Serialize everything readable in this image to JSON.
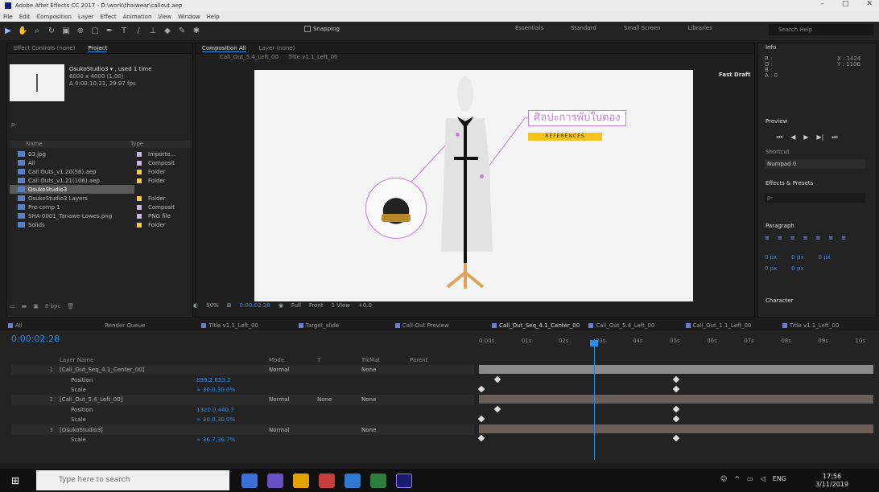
{
  "window": {
    "title": "Adobe After Effects CC 2017 - D:\\work\\thaiwear\\callout.aep"
  },
  "menu": [
    "File",
    "Edit",
    "Composition",
    "Layer",
    "Effect",
    "Animation",
    "View",
    "Window",
    "Help"
  ],
  "toolbar": {
    "snapping_label": "Snapping"
  },
  "workspaces": [
    "Essentials",
    "Standard",
    "Small Screen",
    "Libraries"
  ],
  "search_help": {
    "placeholder": "Search Help"
  },
  "project_panel": {
    "tabs": [
      "Effect Controls (none)",
      "Project"
    ],
    "comp_name": "OsukoStudio3 ▾ , used 1 time",
    "comp_size": "6000 x 4000 (1.00)",
    "comp_duration": "Δ 0:00:10:21, 29.97 fps",
    "headers": [
      "Name",
      "Type"
    ],
    "items": [
      {
        "name": "03.jpg",
        "type": "Importe...",
        "color": "#c7b7e6"
      },
      {
        "name": "All",
        "type": "Composit",
        "color": "#c7b7e6"
      },
      {
        "name": "Call Outs_v1.20(56).aep",
        "type": "Folder",
        "color": "#f2c94c"
      },
      {
        "name": "Call Outs_v1.21(106).aep",
        "type": "Folder",
        "color": "#f2c94c"
      },
      {
        "name": "OsukoStudio3",
        "type": "Composit",
        "color": "#c7b7e6"
      },
      {
        "name": "OsukoStudio3 Layers",
        "type": "Folder",
        "color": "#f2c94c"
      },
      {
        "name": "Pre-comp 1",
        "type": "Composit",
        "color": "#c7b7e6"
      },
      {
        "name": "SHA-0001_Tanawe-Lowes.png",
        "type": "PNG file",
        "color": "#c7b7e6"
      },
      {
        "name": "Solids",
        "type": "Folder",
        "color": "#f2c94c"
      }
    ],
    "footer_bpc": "8 bpc"
  },
  "composition_panel": {
    "tabs": [
      "Composition All",
      "Layer (none)"
    ],
    "breadcrumb": [
      "Call_Out_5.4_Left_00",
      "Title v1.1_Left_00"
    ],
    "frame_label": "Fast Draft",
    "thai_title": "ศิลปะการพับใบตอง",
    "subtitle_bar": "REFERENCES",
    "zoom": "50%",
    "timecode": "0:00:02:28",
    "resolution": "Full",
    "camera": "Front",
    "views": "1 View",
    "exposure": "+0.0"
  },
  "info_panel": {
    "title": "Info",
    "r": "R :",
    "g": "G :",
    "b": "B :",
    "a": "A : 0",
    "x": "X : 1424",
    "y": "Y : 1106"
  },
  "preview_panel": {
    "title": "Preview",
    "shortcut_label": "Shortcut",
    "shortcut_value": "Numpad 0"
  },
  "effects_panel": {
    "title": "Effects & Presets",
    "search_placeholder": "ρ-"
  },
  "paragraph_panel": {
    "title": "Paragraph",
    "val1": "0 px",
    "val2": "0 px",
    "val3": "0 px",
    "val4": "0 px",
    "val5": "0 px"
  },
  "character_panel": {
    "title": "Character"
  },
  "timeline": {
    "tabs": [
      "All",
      "Render Queue",
      "Title v1.1_Left_00",
      "Target_slide",
      "Call-Out Preview",
      "Call_Out_Seq_4.1_Center_00",
      "Call_Out_5.4_Left_00",
      "Call_Out_1.1_Left_00",
      "Title v1.1_Left_00"
    ],
    "timecode": "0:00:02:28",
    "headers": [
      "Layer Name",
      "Mode",
      "T",
      "TrkMat",
      "Parent"
    ],
    "ruler": [
      "0:00s",
      "01s",
      "02s",
      "03s",
      "04s",
      "05s",
      "06s",
      "07s",
      "08s",
      "09s",
      "10s"
    ],
    "rows": [
      {
        "kind": "layer",
        "num": "1",
        "name": "[Call_Out_Seq_4.1_Center_00]",
        "mode": "Normal",
        "trk": "",
        "parent": "None"
      },
      {
        "kind": "prop",
        "num": "",
        "name": "Position",
        "value": "899.2,633.2"
      },
      {
        "kind": "prop",
        "num": "",
        "name": "Scale",
        "value": "∞ 30.0,30.0%"
      },
      {
        "kind": "layer",
        "num": "2",
        "name": "[Call_Out_5.4_Left_00]",
        "mode": "Normal",
        "trk": "None",
        "parent": "None"
      },
      {
        "kind": "prop",
        "num": "",
        "name": "Position",
        "value": "1320.0,440.7"
      },
      {
        "kind": "prop",
        "num": "",
        "name": "Scale",
        "value": "∞ 30.0,30.0%"
      },
      {
        "kind": "layer",
        "num": "3",
        "name": "[OsukoStudio3]",
        "mode": "Normal",
        "trk": "",
        "parent": "None"
      },
      {
        "kind": "prop",
        "num": "",
        "name": "Scale",
        "value": "∞ 36.7,36.7%"
      }
    ]
  },
  "taskbar": {
    "search_placeholder": "Type here to search",
    "lang": "ENG",
    "time": "17:56",
    "date": "3/11/2019",
    "app_colors": [
      "#3a6fd8",
      "#6a4fc7",
      "#e5a100",
      "#c83d3d",
      "#2f78d1",
      "#2d7d3d",
      "#8b78ff"
    ]
  }
}
